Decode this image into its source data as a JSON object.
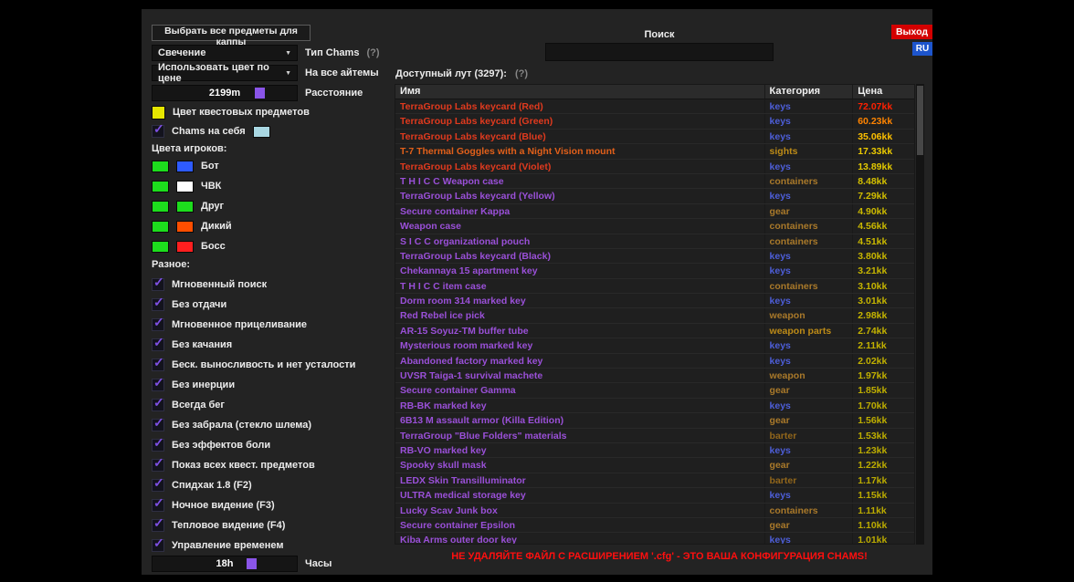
{
  "top": {
    "select_all_label": "Выбрать все предметы для каппы",
    "search_label": "Поиск",
    "search_value": "",
    "exit_label": "Выход",
    "lang_label": "RU"
  },
  "left": {
    "chams_type": {
      "value": "Свечение",
      "label": "Тип Chams",
      "help": "(?)"
    },
    "color_by_price": {
      "value": "Использовать цвет по цене",
      "label": "На все айтемы"
    },
    "distance": {
      "value": "2199m",
      "label": "Расстояние",
      "handle_pct": 71
    },
    "quest_color": {
      "label": "Цвет квестовых предметов",
      "color": "#e6e600"
    },
    "chams_self": {
      "label": "Chams на себя",
      "checked": true,
      "color": "#a9d7e2"
    },
    "player_colors_label": "Цвета игроков:",
    "player_colors": [
      {
        "label": "Бот",
        "color1": "#1ddd1d",
        "color2": "#2e5bff"
      },
      {
        "label": "ЧВК",
        "color1": "#1ddd1d",
        "color2": "#ffffff"
      },
      {
        "label": "Друг",
        "color1": "#1ddd1d",
        "color2": "#1ddd1d"
      },
      {
        "label": "Дикий",
        "color1": "#1ddd1d",
        "color2": "#ff4e00"
      },
      {
        "label": "Босс",
        "color1": "#1ddd1d",
        "color2": "#ff1f1f"
      }
    ],
    "misc_label": "Разное:",
    "misc_checkboxes": [
      {
        "label": "Мгновенный поиск",
        "checked": true
      },
      {
        "label": "Без отдачи",
        "checked": true
      },
      {
        "label": "Мгновенное прицеливание",
        "checked": true
      },
      {
        "label": "Без качания",
        "checked": true
      },
      {
        "label": "Беск. выносливость и нет усталости",
        "checked": true
      },
      {
        "label": "Без инерции",
        "checked": true
      },
      {
        "label": "Всегда бег",
        "checked": true
      },
      {
        "label": "Без забрала (стекло шлема)",
        "checked": true
      },
      {
        "label": "Без эффектов боли",
        "checked": true
      },
      {
        "label": "Показ всех квест. предметов",
        "checked": true
      },
      {
        "label": "Спидхак 1.8 (F2)",
        "checked": true
      },
      {
        "label": "Ночное видение (F3)",
        "checked": true
      },
      {
        "label": "Тепловое видение (F4)",
        "checked": true
      },
      {
        "label": "Управление временем",
        "checked": true
      }
    ],
    "hours": {
      "value": "18h",
      "label": "Часы",
      "handle_pct": 65
    }
  },
  "loot": {
    "title": "Доступный лут (3297):",
    "help": "(?)",
    "columns": [
      "Имя",
      "Категория",
      "Цена"
    ],
    "rows": [
      {
        "name": "TerraGroup Labs keycard (Red)",
        "name_color": "#e03a1e",
        "category": "keys",
        "category_color": "#4d5ed8",
        "price": "72.07kk",
        "price_color": "#ff2000"
      },
      {
        "name": "TerraGroup Labs keycard (Green)",
        "name_color": "#e03a1e",
        "category": "keys",
        "category_color": "#4d5ed8",
        "price": "60.23kk",
        "price_color": "#ff8400"
      },
      {
        "name": "TerraGroup Labs keycard (Blue)",
        "name_color": "#e03a1e",
        "category": "keys",
        "category_color": "#4d5ed8",
        "price": "35.06kk",
        "price_color": "#fdc000"
      },
      {
        "name": "T-7 Thermal Goggles with a Night Vision mount",
        "name_color": "#e2601a",
        "category": "sights",
        "category_color": "#bd8b17",
        "price": "17.33kk",
        "price_color": "#ecca00"
      },
      {
        "name": "TerraGroup Labs keycard (Violet)",
        "name_color": "#e03a1e",
        "category": "keys",
        "category_color": "#4d5ed8",
        "price": "13.89kk",
        "price_color": "#e2c800"
      },
      {
        "name": "T H I C C Weapon case",
        "name_color": "#9a50d8",
        "category": "containers",
        "category_color": "#a9792a",
        "price": "8.48kk",
        "price_color": "#d4c000"
      },
      {
        "name": "TerraGroup Labs keycard (Yellow)",
        "name_color": "#9a50d8",
        "category": "keys",
        "category_color": "#4d5ed8",
        "price": "7.29kk",
        "price_color": "#d2be00"
      },
      {
        "name": "Secure container Kappa",
        "name_color": "#9a50d8",
        "category": "gear",
        "category_color": "#a9792a",
        "price": "4.90kk",
        "price_color": "#ccba00"
      },
      {
        "name": "Weapon case",
        "name_color": "#9a50d8",
        "category": "containers",
        "category_color": "#a9792a",
        "price": "4.56kk",
        "price_color": "#cbb900"
      },
      {
        "name": "S I C C organizational pouch",
        "name_color": "#9a50d8",
        "category": "containers",
        "category_color": "#a9792a",
        "price": "4.51kk",
        "price_color": "#cbb900"
      },
      {
        "name": "TerraGroup Labs keycard (Black)",
        "name_color": "#9a50d8",
        "category": "keys",
        "category_color": "#4d5ed8",
        "price": "3.80kk",
        "price_color": "#c8b600"
      },
      {
        "name": "Chekannaya 15 apartment key",
        "name_color": "#9a50d8",
        "category": "keys",
        "category_color": "#4d5ed8",
        "price": "3.21kk",
        "price_color": "#c6b500"
      },
      {
        "name": "T H I C C item case",
        "name_color": "#9a50d8",
        "category": "containers",
        "category_color": "#a9792a",
        "price": "3.10kk",
        "price_color": "#c6b500"
      },
      {
        "name": "Dorm room 314 marked key",
        "name_color": "#9a50d8",
        "category": "keys",
        "category_color": "#4d5ed8",
        "price": "3.01kk",
        "price_color": "#c5b400"
      },
      {
        "name": "Red Rebel ice pick",
        "name_color": "#9a50d8",
        "category": "weapon",
        "category_color": "#a9792a",
        "price": "2.98kk",
        "price_color": "#c5b400"
      },
      {
        "name": "AR-15 Soyuz-TM buffer tube",
        "name_color": "#9a50d8",
        "category": "weapon parts",
        "category_color": "#bd8b17",
        "price": "2.74kk",
        "price_color": "#c4b300"
      },
      {
        "name": "Mysterious room marked key",
        "name_color": "#9a50d8",
        "category": "keys",
        "category_color": "#4d5ed8",
        "price": "2.11kk",
        "price_color": "#c2b100"
      },
      {
        "name": "Abandoned factory marked key",
        "name_color": "#9a50d8",
        "category": "keys",
        "category_color": "#4d5ed8",
        "price": "2.02kk",
        "price_color": "#c1b000"
      },
      {
        "name": "UVSR Taiga-1 survival machete",
        "name_color": "#9a50d8",
        "category": "weapon",
        "category_color": "#a9792a",
        "price": "1.97kk",
        "price_color": "#c1b000"
      },
      {
        "name": "Secure container Gamma",
        "name_color": "#9a50d8",
        "category": "gear",
        "category_color": "#a9792a",
        "price": "1.85kk",
        "price_color": "#c0af00"
      },
      {
        "name": "RB-BK marked key",
        "name_color": "#9a50d8",
        "category": "keys",
        "category_color": "#4d5ed8",
        "price": "1.70kk",
        "price_color": "#bfae00"
      },
      {
        "name": "6B13 M assault armor (Killa Edition)",
        "name_color": "#9a50d8",
        "category": "gear",
        "category_color": "#a9792a",
        "price": "1.56kk",
        "price_color": "#beae00"
      },
      {
        "name": "TerraGroup \"Blue Folders\" materials",
        "name_color": "#9a50d8",
        "category": "barter",
        "category_color": "#91661b",
        "price": "1.53kk",
        "price_color": "#beae00"
      },
      {
        "name": "RB-VO marked key",
        "name_color": "#9a50d8",
        "category": "keys",
        "category_color": "#4d5ed8",
        "price": "1.23kk",
        "price_color": "#bcac00"
      },
      {
        "name": "Spooky skull mask",
        "name_color": "#9a50d8",
        "category": "gear",
        "category_color": "#a9792a",
        "price": "1.22kk",
        "price_color": "#bcac00"
      },
      {
        "name": "LEDX Skin Transilluminator",
        "name_color": "#9a50d8",
        "category": "barter",
        "category_color": "#91661b",
        "price": "1.17kk",
        "price_color": "#bbab00"
      },
      {
        "name": "ULTRA medical storage key",
        "name_color": "#9a50d8",
        "category": "keys",
        "category_color": "#4d5ed8",
        "price": "1.15kk",
        "price_color": "#bbab00"
      },
      {
        "name": "Lucky Scav Junk box",
        "name_color": "#9a50d8",
        "category": "containers",
        "category_color": "#a9792a",
        "price": "1.11kk",
        "price_color": "#bbab00"
      },
      {
        "name": "Secure container Epsilon",
        "name_color": "#9a50d8",
        "category": "gear",
        "category_color": "#a9792a",
        "price": "1.10kk",
        "price_color": "#baaa00"
      },
      {
        "name": "Kiba Arms outer door key",
        "name_color": "#9a50d8",
        "category": "keys",
        "category_color": "#4d5ed8",
        "price": "1.01kk",
        "price_color": "#baaa00"
      }
    ]
  },
  "footer": {
    "warning": "НЕ УДАЛЯЙТЕ ФАЙЛ С РАСШИРЕНИЕМ '.cfg' - ЭТО ВАША КОНФИГУРАЦИЯ CHAMS!"
  }
}
